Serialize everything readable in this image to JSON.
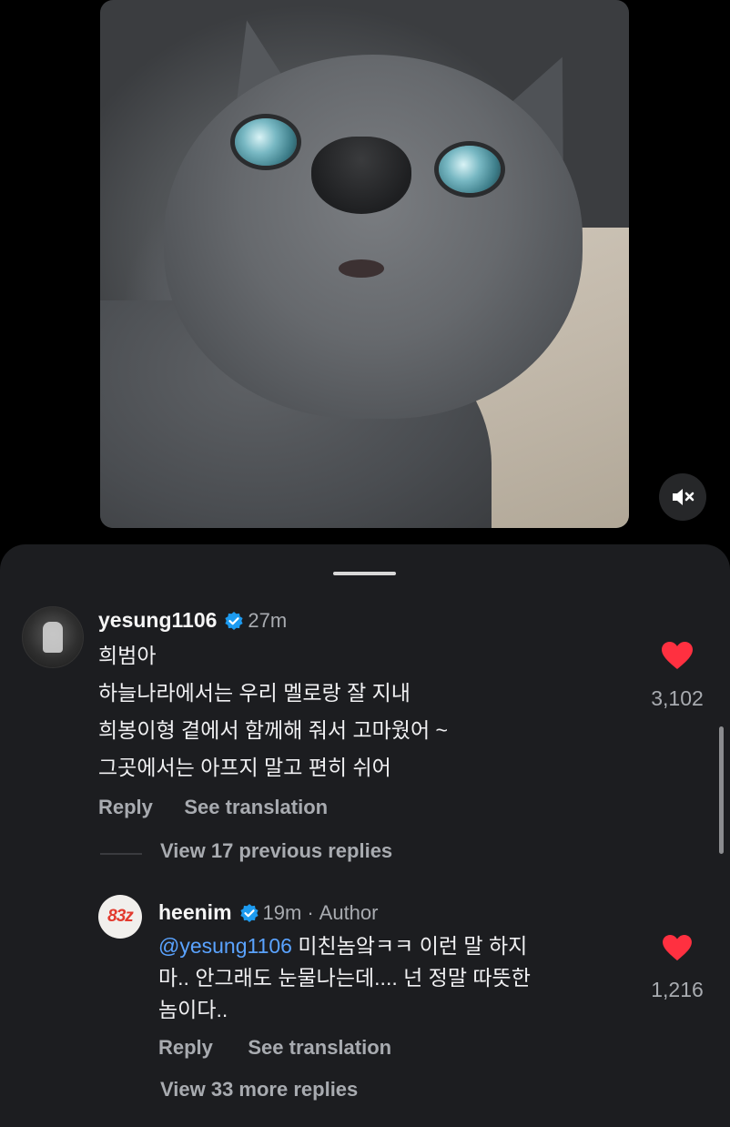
{
  "post": {
    "media_alt": "cat photo",
    "mute_icon": "speaker-muted-icon"
  },
  "comments": {
    "main": {
      "username": "yesung1106",
      "time": "27m",
      "lines": [
        "희범아",
        "하늘나라에서는 우리 멜로랑 잘 지내",
        "희봉이형 곁에서 함께해 줘서 고마웠어 ~",
        "그곳에서는 아프지 말고 편히 쉬어"
      ],
      "likes": "3,102",
      "reply_label": "Reply",
      "translate_label": "See translation"
    },
    "view_previous": "View 17 previous replies",
    "reply": {
      "username": "heenim",
      "avatar_text": "83z",
      "time": "19m",
      "role": "Author",
      "mention": "@yesung1106",
      "lines": [
        " 미친놈앜ㅋㅋ 이런 말 하지",
        "마.. 안그래도 눈물나는데.... 넌 정말 따뜻한",
        "놈이다.."
      ],
      "likes": "1,216",
      "reply_label": "Reply",
      "translate_label": "See translation"
    },
    "view_more": "View 33 more replies"
  },
  "colors": {
    "sheet_bg": "#1c1d20",
    "heart": "#ff3040",
    "verified": "#1d9bf0",
    "muted_text": "#a8abb0"
  }
}
